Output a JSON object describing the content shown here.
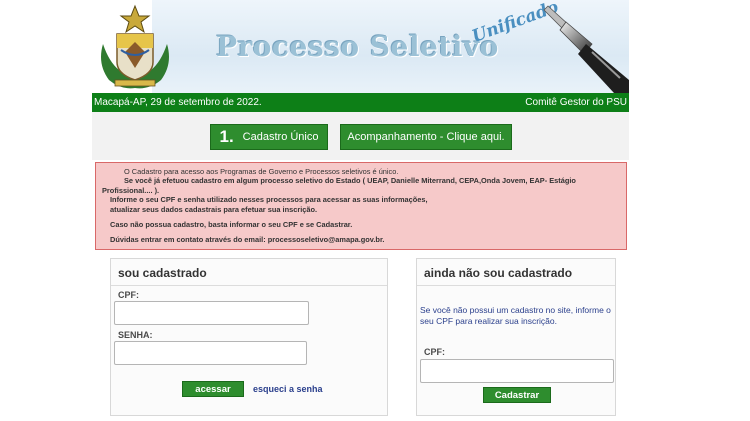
{
  "header": {
    "title": "Processo Seletivo",
    "subtitle_script": "Unificado",
    "emblem_icon": "amapa-state-coat-of-arms"
  },
  "topbar": {
    "date": "Macapá-AP, 29 de setembro de 2022.",
    "org": "Comitê Gestor do PSU"
  },
  "nav": {
    "cadastro_number": "1.",
    "cadastro_label": "Cadastro Único",
    "acompanhamento_label": "Acompanhamento - Clique aqui."
  },
  "info": {
    "line1": "O Cadastro para acesso aos Programas de Governo e Processos seletivos é único.",
    "line2": "Se você já efetuou cadastro em algum processo seletivo do Estado ( UEAP, Danielle Miterrand, CEPA,Onda Jovem, EAP- Estágio",
    "line3": "Profissional.... ).",
    "line4": "Informe o seu CPF e senha utilizado nesses processos para acessar as suas informações,",
    "line5": "atualizar seus dados cadastrais para efetuar sua inscrição.",
    "line6": "Caso não possua cadastro, basta informar o seu CPF e se Cadastrar.",
    "line7": "Dúvidas entrar em contato através do email: processoseletivo@amapa.gov.br."
  },
  "login": {
    "heading": "sou cadastrado",
    "cpf_label": "CPF:",
    "senha_label": "SENHA:",
    "submit_label": "acessar",
    "forgot_label": "esqueci a senha"
  },
  "register": {
    "heading": "ainda não sou cadastrado",
    "text": "Se você não possui um cadastro no site, informe o seu CPF para realizar sua inscrição.",
    "cpf_label": "CPF:",
    "submit_label": "Cadastrar"
  },
  "colors": {
    "green": "#0d7f17",
    "button_green": "#2e8d2e",
    "info_bg": "#f6c9c9",
    "info_border": "#d96868",
    "link_blue": "#2a3f8c"
  }
}
